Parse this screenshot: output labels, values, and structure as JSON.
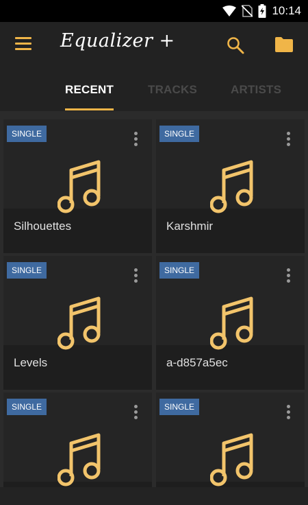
{
  "status": {
    "time": "10:14"
  },
  "app_bar": {
    "title": "Equalizer +",
    "icons": [
      "menu-icon",
      "search-icon",
      "folder-icon"
    ]
  },
  "tabs": [
    {
      "label": "RECENT",
      "active": true
    },
    {
      "label": "TRACKS",
      "active": false
    },
    {
      "label": "ARTISTS",
      "active": false
    }
  ],
  "cards": [
    {
      "badge": "SINGLE",
      "title": "Silhouettes"
    },
    {
      "badge": "SINGLE",
      "title": "Karshmir"
    },
    {
      "badge": "SINGLE",
      "title": "Levels"
    },
    {
      "badge": "SINGLE",
      "title": "a-d857a5ec"
    },
    {
      "badge": "SINGLE",
      "title": ""
    },
    {
      "badge": "SINGLE",
      "title": ""
    }
  ],
  "colors": {
    "accent": "#f0b548",
    "badge": "#3f6aa0",
    "background": "#2b2b2b",
    "bar": "#222222"
  }
}
